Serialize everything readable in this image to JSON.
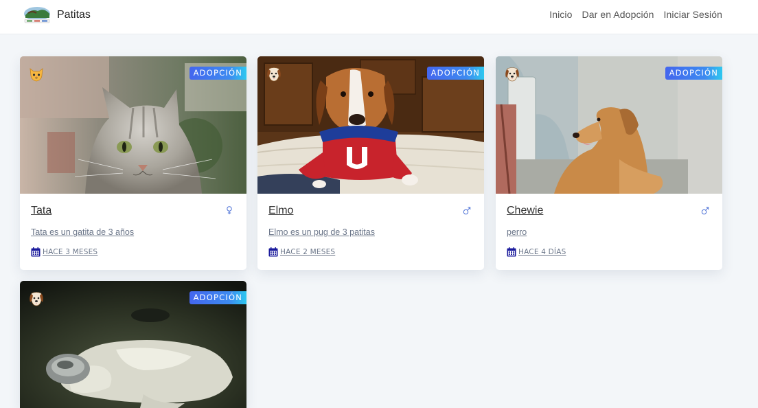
{
  "navbar": {
    "brand_name": "Patitas",
    "links": [
      {
        "label": "Inicio"
      },
      {
        "label": "Dar en Adopción"
      },
      {
        "label": "Iniciar Sesión"
      }
    ]
  },
  "cards": [
    {
      "species": "cat",
      "badge": "ADOPCIÓN",
      "name": "Tata",
      "sex": "female",
      "description": "Tata es un gatita de 3 años",
      "date": "HACE 3 MESES"
    },
    {
      "species": "dog",
      "badge": "ADOPCIÓN",
      "name": "Elmo",
      "sex": "male",
      "description": "Elmo es un pug de 3 patitas",
      "date": "HACE 2 MESES"
    },
    {
      "species": "dog",
      "badge": "ADOPCIÓN",
      "name": "Chewie",
      "sex": "male",
      "description": "perro",
      "date": "HACE 4 DÍAS"
    },
    {
      "species": "dog",
      "badge": "ADOPCIÓN"
    }
  ],
  "icons": {
    "cat_icon": "cat-face-icon",
    "dog_icon": "dog-face-icon",
    "female_icon": "female-sign-icon",
    "male_icon": "male-sign-icon",
    "date_icon": "calendar-icon"
  },
  "colors": {
    "badge_gradient_start": "#4466ee",
    "badge_gradient_end": "#2ec8ef",
    "calendar": "#1a1a9c",
    "page_background": "#f3f6f9"
  }
}
